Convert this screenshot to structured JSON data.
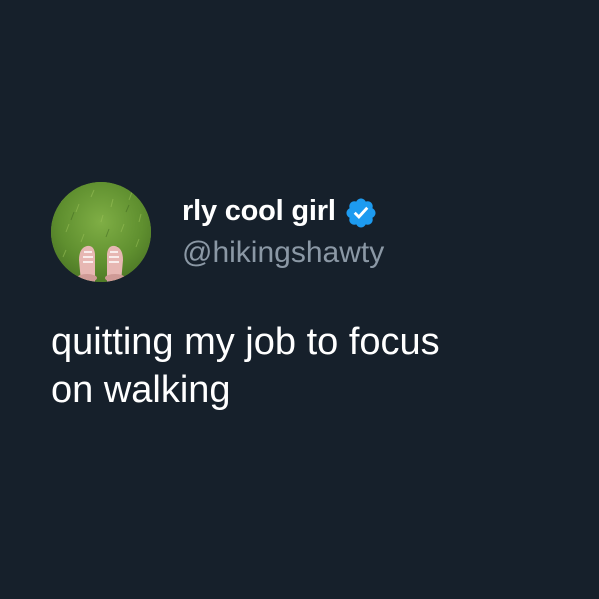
{
  "tweet": {
    "author": {
      "display_name": "rly cool girl",
      "handle": "@hikingshawty",
      "verified": true,
      "avatar_icon": "avatar-sneakers-on-grass"
    },
    "text_lines": [
      "quitting my job to focus",
      "on walking"
    ]
  },
  "colors": {
    "background": "#16202b",
    "display_name": "#ffffff",
    "handle": "#8b98a5",
    "verified_badge": "#1d9bf0",
    "text": "#ffffff"
  }
}
